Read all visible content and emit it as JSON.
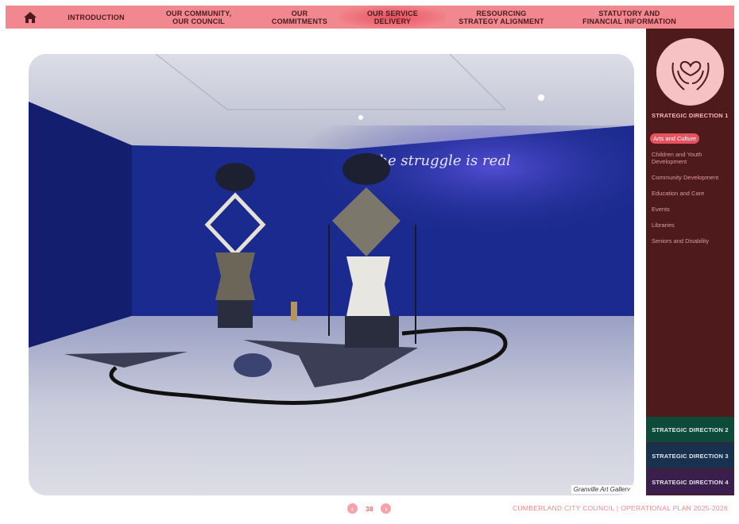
{
  "nav": {
    "items": [
      {
        "label": "INTRODUCTION"
      },
      {
        "label": "OUR COMMUNITY,\nOUR COUNCIL"
      },
      {
        "label": "OUR\nCOMMITMENTS"
      },
      {
        "label": "OUR SERVICE\nDELIVERY"
      },
      {
        "label": "RESOURCING\nSTRATEGY ALIGNMENT"
      },
      {
        "label": "STATUTORY AND\nFINANCIAL INFORMATION"
      }
    ],
    "active_index": 3
  },
  "photo": {
    "caption": "Granville Art Gallery",
    "neon_text": "the struggle is real"
  },
  "sidebar": {
    "title": "STRATEGIC DIRECTION 1",
    "items": [
      {
        "label": "Arts and Culture"
      },
      {
        "label": "Children and Youth Development"
      },
      {
        "label": "Community Development"
      },
      {
        "label": "Education and Care"
      },
      {
        "label": "Events"
      },
      {
        "label": "Libraries"
      },
      {
        "label": "Seniors and Disability"
      }
    ],
    "directions": [
      {
        "label": "STRATEGIC DIRECTION 2",
        "color": "#0e4a3a"
      },
      {
        "label": "STRATEGIC DIRECTION 3",
        "color": "#17314f"
      },
      {
        "label": "STRATEGIC DIRECTION 4",
        "color": "#3a1f4d"
      }
    ]
  },
  "footer": {
    "page_number": "38",
    "council": "CUMBERLAND CITY COUNCIL",
    "separator": "|",
    "plan": "OPERATIONAL PLAN 2025-2026"
  },
  "colors": {
    "nav_bg": "#f2888f",
    "sidebar_bg": "#4e1a1c",
    "accent": "#e8525e"
  }
}
